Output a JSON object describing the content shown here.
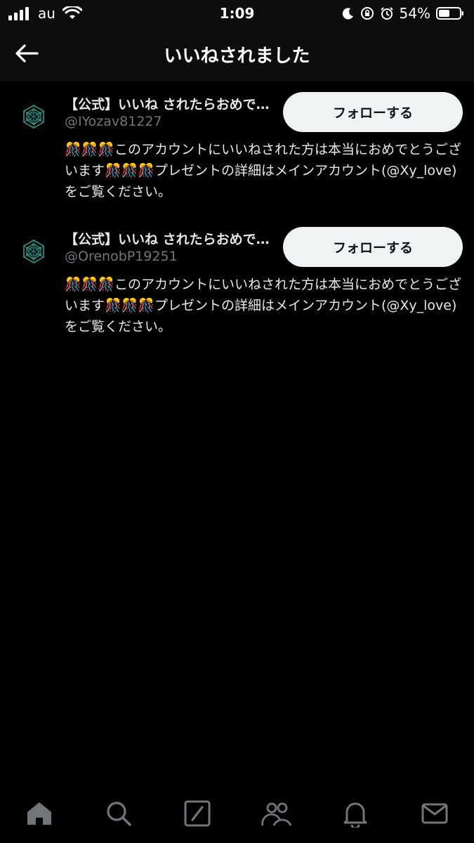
{
  "status_bar": {
    "carrier": "au",
    "time": "1:09",
    "battery": "54%"
  },
  "header": {
    "title": "いいねされました"
  },
  "users": [
    {
      "name": "【公式】いいね されたらおめでとうございます",
      "handle": "@IYozav81227",
      "follow_label": "フォローする",
      "bio": "🎊🎊🎊このアカウントにいいねされた方は本当におめでとうございます🎊🎊🎊プレゼントの詳細はメインアカウント(@Xy_love)をご覧ください。"
    },
    {
      "name": "【公式】いいね されたらおめでとうございます",
      "handle": "@OrenobP19251",
      "follow_label": "フォローする",
      "bio": "🎊🎊🎊このアカウントにいいねされた方は本当におめでとうございます🎊🎊🎊プレゼントの詳細はメインアカウント(@Xy_love)をご覧ください。"
    }
  ],
  "tabs": [
    {
      "icon": "home-icon"
    },
    {
      "icon": "search-icon"
    },
    {
      "icon": "compose-icon"
    },
    {
      "icon": "communities-icon"
    },
    {
      "icon": "bell-icon"
    },
    {
      "icon": "mail-icon"
    }
  ],
  "colors": {
    "background": "#000000",
    "header_bg": "#0d0d0d",
    "button_bg": "#eff3f4",
    "handle": "#71767b",
    "avatar_teal": "#2fa38f"
  }
}
